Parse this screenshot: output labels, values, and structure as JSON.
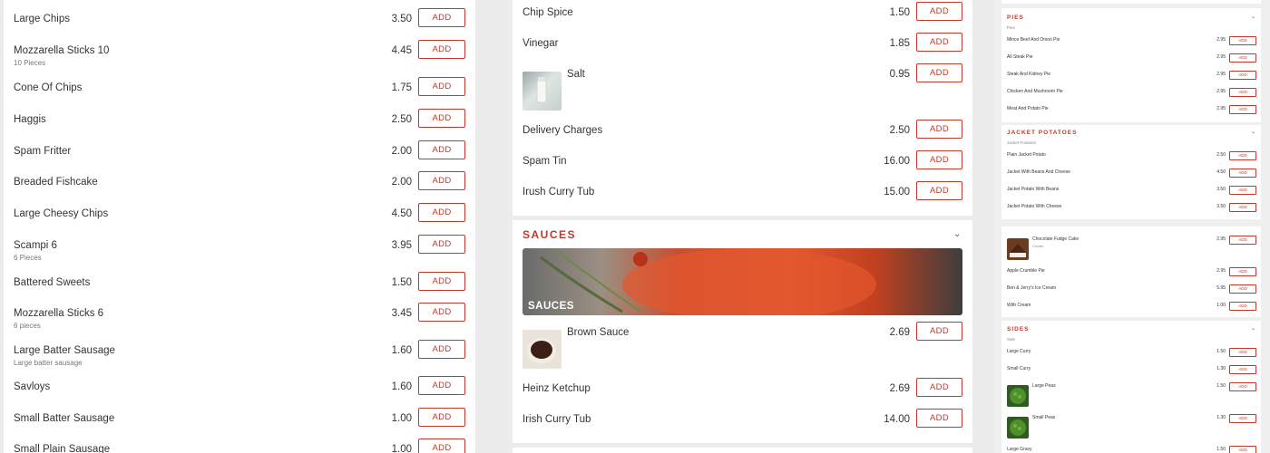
{
  "colors": {
    "accent": "#c0392b",
    "page_bg": "#ececec",
    "panel_bg": "#ffffff"
  },
  "left_menu": {
    "items": [
      {
        "name": "Large Chips",
        "desc": "",
        "price": "3.50",
        "button": "ADD"
      },
      {
        "name": "Mozzarella Sticks 10",
        "desc": "10 Pieces",
        "price": "4.45",
        "button": "ADD"
      },
      {
        "name": "Cone Of Chips",
        "desc": "",
        "price": "1.75",
        "button": "ADD"
      },
      {
        "name": "Haggis",
        "desc": "",
        "price": "2.50",
        "button": "ADD"
      },
      {
        "name": "Spam Fritter",
        "desc": "",
        "price": "2.00",
        "button": "ADD"
      },
      {
        "name": "Breaded Fishcake",
        "desc": "",
        "price": "2.00",
        "button": "ADD"
      },
      {
        "name": "Large Cheesy Chips",
        "desc": "",
        "price": "4.50",
        "button": "ADD"
      },
      {
        "name": "Scampi 6",
        "desc": "6 Pieces",
        "price": "3.95",
        "button": "ADD"
      },
      {
        "name": "Battered Sweets",
        "desc": "",
        "price": "1.50",
        "button": "ADD"
      },
      {
        "name": "Mozzarella Sticks 6",
        "desc": "6 pieces",
        "price": "3.45",
        "button": "ADD"
      },
      {
        "name": "Large Batter Sausage",
        "desc": "Large batter sausage",
        "price": "1.60",
        "button": "ADD"
      },
      {
        "name": "Savloys",
        "desc": "",
        "price": "1.60",
        "button": "ADD"
      },
      {
        "name": "Small Batter Sausage",
        "desc": "",
        "price": "1.00",
        "button": "ADD"
      },
      {
        "name": "Small Plain Sausage",
        "desc": "",
        "price": "1.00",
        "button": "ADD"
      }
    ]
  },
  "middle_menu": {
    "top_items": [
      {
        "name": "Chip Spice",
        "price": "1.50",
        "button": "ADD",
        "icon": ""
      },
      {
        "name": "Vinegar",
        "price": "1.85",
        "button": "ADD",
        "icon": ""
      },
      {
        "name": "Salt",
        "price": "0.95",
        "button": "ADD",
        "icon": "salt-thumbnail"
      },
      {
        "name": "Delivery Charges",
        "price": "2.50",
        "button": "ADD",
        "icon": ""
      },
      {
        "name": "Spam Tin",
        "price": "16.00",
        "button": "ADD",
        "icon": ""
      },
      {
        "name": "Irush Curry Tub",
        "price": "15.00",
        "button": "ADD",
        "icon": ""
      }
    ],
    "sauces": {
      "title": "SAUCES",
      "banner_label": "SAUCES",
      "items": [
        {
          "name": "Brown Sauce",
          "price": "2.69",
          "button": "ADD",
          "icon": "brown-sauce-thumbnail"
        },
        {
          "name": "Heinz Ketchup",
          "price": "2.69",
          "button": "ADD",
          "icon": ""
        },
        {
          "name": "Irish Curry Tub",
          "price": "14.00",
          "button": "ADD",
          "icon": ""
        }
      ]
    }
  },
  "right_menu": {
    "pies": {
      "title": "PIES",
      "subtitle": "Pies",
      "items": [
        {
          "name": "Mince Beef And Onion Pie",
          "price": "2.95",
          "button": "ADD"
        },
        {
          "name": "All Steak Pie",
          "price": "2.95",
          "button": "ADD"
        },
        {
          "name": "Steak And Kidney Pie",
          "price": "2.95",
          "button": "ADD"
        },
        {
          "name": "Chicken And Mushroom Pie",
          "price": "2.95",
          "button": "ADD"
        },
        {
          "name": "Meat And Potato Pie",
          "price": "2.95",
          "button": "ADD"
        }
      ]
    },
    "jacket": {
      "title": "JACKET POTATOES",
      "subtitle": "Jacket Potatoes",
      "items": [
        {
          "name": "Plain Jacket Potato",
          "price": "2.50",
          "button": "ADD"
        },
        {
          "name": "Jacket With Beans And Cheese",
          "price": "4.50",
          "button": "ADD"
        },
        {
          "name": "Jacket Potato With Beans",
          "price": "3.50",
          "button": "ADD"
        },
        {
          "name": "Jacket Potato With Cheese",
          "price": "3.50",
          "button": "ADD"
        }
      ]
    },
    "desserts": {
      "items": [
        {
          "name": "Chocolate Fudge Cake",
          "desc": "Cream",
          "price": "2.95",
          "button": "ADD",
          "icon": "cake-thumbnail"
        },
        {
          "name": "Apple Crumble Pie",
          "desc": "",
          "price": "2.95",
          "button": "ADD",
          "icon": ""
        },
        {
          "name": "Ben & Jerry's Ice Cream",
          "desc": "",
          "price": "5.95",
          "button": "ADD",
          "icon": ""
        },
        {
          "name": "With Cream",
          "desc": "",
          "price": "1.00",
          "button": "ADD",
          "icon": ""
        }
      ]
    },
    "sides": {
      "title": "SIDES",
      "subtitle": "Side",
      "items": [
        {
          "name": "Large Curry",
          "price": "1.50",
          "button": "ADD",
          "icon": ""
        },
        {
          "name": "Small Curry",
          "price": "1.30",
          "button": "ADD",
          "icon": ""
        },
        {
          "name": "Large Peas",
          "price": "1.50",
          "button": "ADD",
          "icon": "peas-thumbnail"
        },
        {
          "name": "Small Peas",
          "price": "1.30",
          "button": "ADD",
          "icon": "peas-thumbnail"
        },
        {
          "name": "Large Gravy",
          "price": "1.50",
          "button": "ADD",
          "icon": ""
        }
      ]
    }
  }
}
